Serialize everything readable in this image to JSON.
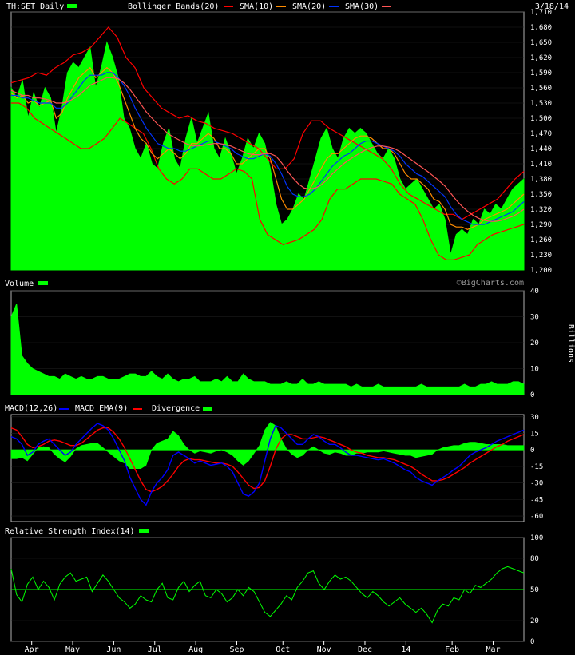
{
  "header": {
    "symbol": "TH:SET Daily",
    "overlays": [
      "Bollinger Bands(20)",
      "SMA(10)",
      "SMA(20)",
      "SMA(30)"
    ],
    "date": "3/18/14",
    "watermark": "©BigCharts.com"
  },
  "colors": {
    "background": "#000000",
    "panel_bg": "#ffffff",
    "grid": "#c8c8c8",
    "price_fill": "#00ff00",
    "bollinger": "#ff0000",
    "sma10": "#ff8c00",
    "sma20": "#0033ff",
    "sma30": "#ff5555",
    "macd": "#0000ff",
    "macd_ema": "#ff0000",
    "rsi": "#00ff00"
  },
  "chart_data": [
    {
      "type": "area",
      "id": "price",
      "ylim": [
        1200,
        1710
      ],
      "yticks": [
        "1,200",
        "1,230",
        "1,260",
        "1,290",
        "1,320",
        "1,350",
        "1,380",
        "1,410",
        "1,440",
        "1,470",
        "1,500",
        "1,530",
        "1,560",
        "1,590",
        "1,620",
        "1,650",
        "1,680",
        "1,710"
      ],
      "ytick_values": [
        1200,
        1230,
        1260,
        1290,
        1320,
        1350,
        1380,
        1410,
        1440,
        1470,
        1500,
        1530,
        1560,
        1590,
        1620,
        1650,
        1680,
        1710
      ],
      "xlim": [
        0,
        240
      ],
      "series": [
        {
          "values": [
            1560,
            1540,
            1575,
            1500,
            1550,
            1520,
            1560,
            1540,
            1470,
            1520,
            1590,
            1610,
            1600,
            1620,
            1640,
            1560,
            1600,
            1650,
            1620,
            1580,
            1500,
            1480,
            1440,
            1420,
            1450,
            1410,
            1400,
            1450,
            1480,
            1420,
            1400,
            1460,
            1500,
            1450,
            1480,
            1510,
            1440,
            1420,
            1460,
            1430,
            1390,
            1420,
            1460,
            1440,
            1470,
            1450,
            1400,
            1330,
            1290,
            1300,
            1320,
            1350,
            1340,
            1380,
            1420,
            1460,
            1480,
            1440,
            1420,
            1460,
            1480,
            1470,
            1480,
            1470,
            1450,
            1430,
            1420,
            1440,
            1420,
            1380,
            1360,
            1370,
            1380,
            1360,
            1340,
            1320,
            1330,
            1300,
            1230,
            1270,
            1280,
            1270,
            1300,
            1290,
            1320,
            1310,
            1330,
            1320,
            1340,
            1360,
            1370,
            1380
          ]
        },
        {
          "values": [
            1570,
            1575,
            1580,
            1590,
            1585,
            1600,
            1610,
            1625,
            1630,
            1640,
            1660,
            1680,
            1660,
            1620,
            1600,
            1560,
            1540,
            1520,
            1510,
            1500,
            1505,
            1495,
            1490,
            1480,
            1475,
            1470,
            1460,
            1450,
            1440,
            1420,
            1400,
            1400,
            1420,
            1470,
            1495,
            1495,
            1480,
            1470,
            1460,
            1450,
            1440,
            1430,
            1420,
            1400,
            1370,
            1350,
            1340,
            1330,
            1320,
            1310,
            1310,
            1300,
            1310,
            1320,
            1330,
            1340,
            1360,
            1380,
            1395
          ]
        },
        {
          "values": [
            1550,
            1540,
            1545,
            1530,
            1535,
            1525,
            1530,
            1535,
            1500,
            1510,
            1540,
            1560,
            1580,
            1590,
            1600,
            1580,
            1590,
            1600,
            1590,
            1570,
            1540,
            1510,
            1480,
            1460,
            1450,
            1430,
            1420,
            1430,
            1440,
            1430,
            1420,
            1430,
            1450,
            1450,
            1460,
            1470,
            1460,
            1440,
            1440,
            1430,
            1410,
            1410,
            1420,
            1430,
            1440,
            1440,
            1420,
            1380,
            1340,
            1320,
            1320,
            1330,
            1340,
            1360,
            1380,
            1400,
            1420,
            1430,
            1430,
            1440,
            1450,
            1460,
            1465,
            1465,
            1460,
            1450,
            1440,
            1440,
            1430,
            1410,
            1390,
            1380,
            1380,
            1370,
            1360,
            1340,
            1335,
            1320,
            1290,
            1285,
            1285,
            1280,
            1285,
            1290,
            1300,
            1305,
            1310,
            1315,
            1320,
            1330,
            1340,
            1350
          ]
        },
        {
          "values": [
            1545,
            1545,
            1540,
            1540,
            1535,
            1530,
            1530,
            1530,
            1520,
            1520,
            1530,
            1545,
            1560,
            1575,
            1585,
            1585,
            1585,
            1590,
            1590,
            1580,
            1565,
            1545,
            1520,
            1500,
            1480,
            1465,
            1450,
            1445,
            1440,
            1440,
            1435,
            1435,
            1440,
            1445,
            1450,
            1455,
            1455,
            1450,
            1445,
            1440,
            1430,
            1425,
            1420,
            1420,
            1425,
            1430,
            1425,
            1410,
            1390,
            1365,
            1350,
            1345,
            1345,
            1350,
            1360,
            1375,
            1390,
            1405,
            1415,
            1425,
            1430,
            1440,
            1450,
            1455,
            1455,
            1450,
            1445,
            1440,
            1435,
            1425,
            1410,
            1400,
            1390,
            1385,
            1375,
            1365,
            1355,
            1345,
            1325,
            1310,
            1300,
            1295,
            1290,
            1290,
            1290,
            1295,
            1300,
            1305,
            1310,
            1315,
            1325,
            1335
          ]
        },
        {
          "values": [
            1555,
            1550,
            1545,
            1545,
            1540,
            1540,
            1538,
            1535,
            1530,
            1530,
            1532,
            1538,
            1545,
            1555,
            1565,
            1570,
            1575,
            1580,
            1580,
            1578,
            1570,
            1558,
            1543,
            1528,
            1512,
            1500,
            1488,
            1478,
            1468,
            1462,
            1456,
            1450,
            1446,
            1445,
            1446,
            1448,
            1450,
            1450,
            1448,
            1445,
            1440,
            1435,
            1430,
            1428,
            1428,
            1430,
            1430,
            1425,
            1412,
            1396,
            1382,
            1370,
            1362,
            1360,
            1362,
            1368,
            1378,
            1390,
            1400,
            1410,
            1418,
            1425,
            1432,
            1438,
            1442,
            1445,
            1445,
            1443,
            1440,
            1434,
            1426,
            1418,
            1410,
            1402,
            1394,
            1385,
            1376,
            1366,
            1352,
            1338,
            1326,
            1316,
            1308,
            1302,
            1298,
            1296,
            1296,
            1298,
            1302,
            1306,
            1312,
            1320
          ]
        },
        {
          "values": [
            1530,
            1530,
            1520,
            1500,
            1490,
            1480,
            1470,
            1460,
            1450,
            1440,
            1440,
            1450,
            1460,
            1480,
            1500,
            1490,
            1480,
            1470,
            1440,
            1400,
            1380,
            1370,
            1380,
            1400,
            1400,
            1390,
            1380,
            1380,
            1390,
            1400,
            1395,
            1380,
            1300,
            1270,
            1260,
            1250,
            1255,
            1260,
            1270,
            1280,
            1300,
            1340,
            1360,
            1360,
            1370,
            1380,
            1380,
            1380,
            1375,
            1370,
            1350,
            1340,
            1330,
            1300,
            1260,
            1230,
            1220,
            1220,
            1225,
            1230,
            1250,
            1260,
            1270,
            1275,
            1280,
            1285,
            1290
          ]
        }
      ]
    },
    {
      "type": "area",
      "id": "volume",
      "title": "Volume",
      "ylabel": "Billions",
      "ylim": [
        0,
        40
      ],
      "yticks": [
        "0",
        "10",
        "20",
        "30",
        "40"
      ],
      "ytick_values": [
        0,
        10,
        20,
        30,
        40
      ],
      "values": [
        30,
        35,
        15,
        12,
        10,
        9,
        8,
        7,
        7,
        6,
        8,
        7,
        6,
        7,
        6,
        6,
        7,
        7,
        6,
        6,
        6,
        7,
        8,
        8,
        7,
        7,
        9,
        7,
        6,
        8,
        6,
        5,
        6,
        6,
        7,
        5,
        5,
        5,
        6,
        5,
        7,
        5,
        5,
        8,
        6,
        5,
        5,
        5,
        4,
        4,
        4,
        5,
        4,
        4,
        6,
        4,
        4,
        5,
        4,
        4,
        4,
        4,
        4,
        3,
        4,
        3,
        3,
        3,
        4,
        3,
        3,
        3,
        3,
        3,
        3,
        3,
        4,
        3,
        3,
        3,
        3,
        3,
        3,
        3,
        4,
        3,
        3,
        4,
        4,
        5,
        4,
        4,
        4,
        5,
        5,
        4
      ]
    },
    {
      "type": "line",
      "id": "macd",
      "title": "MACD(12,26)",
      "series_names": [
        "MACD EMA(9)",
        "Divergence"
      ],
      "ylim": [
        -65,
        32
      ],
      "yticks": [
        "30",
        "15",
        "0",
        "-15",
        "-30",
        "-45",
        "-60"
      ],
      "ytick_values": [
        30,
        15,
        0,
        -15,
        -30,
        -45,
        -60
      ],
      "series": [
        {
          "values": [
            12,
            10,
            5,
            -5,
            -2,
            5,
            8,
            10,
            5,
            0,
            -5,
            -2,
            5,
            10,
            15,
            20,
            24,
            22,
            18,
            10,
            0,
            -10,
            -25,
            -35,
            -45,
            -50,
            -38,
            -30,
            -25,
            -18,
            -5,
            -2,
            -5,
            -8,
            -12,
            -10,
            -12,
            -14,
            -13,
            -12,
            -15,
            -20,
            -30,
            -40,
            -42,
            -38,
            -30,
            -10,
            10,
            22,
            20,
            15,
            10,
            5,
            5,
            10,
            14,
            12,
            8,
            5,
            5,
            2,
            -2,
            -5,
            -5,
            -6,
            -7,
            -8,
            -9,
            -8,
            -10,
            -12,
            -15,
            -18,
            -20,
            -25,
            -28,
            -30,
            -32,
            -28,
            -25,
            -22,
            -18,
            -15,
            -10,
            -5,
            -2,
            0,
            2,
            5,
            8,
            10,
            12,
            14,
            16,
            18
          ]
        },
        {
          "values": [
            20,
            18,
            12,
            5,
            2,
            3,
            5,
            8,
            9,
            8,
            6,
            4,
            4,
            6,
            10,
            14,
            18,
            20,
            20,
            16,
            10,
            2,
            -8,
            -18,
            -28,
            -36,
            -38,
            -36,
            -33,
            -28,
            -22,
            -15,
            -10,
            -8,
            -9,
            -9,
            -10,
            -11,
            -12,
            -12,
            -13,
            -15,
            -20,
            -26,
            -32,
            -35,
            -34,
            -28,
            -15,
            0,
            10,
            14,
            14,
            12,
            10,
            10,
            11,
            12,
            11,
            9,
            7,
            5,
            3,
            0,
            -2,
            -3,
            -5,
            -6,
            -7,
            -7,
            -8,
            -9,
            -11,
            -13,
            -15,
            -18,
            -22,
            -25,
            -28,
            -28,
            -27,
            -25,
            -22,
            -19,
            -16,
            -12,
            -9,
            -6,
            -3,
            0,
            3,
            5,
            8,
            10,
            12,
            14
          ]
        }
      ],
      "histogram": [
        -8,
        -8,
        -7,
        -10,
        -4,
        2,
        3,
        2,
        -4,
        -8,
        -11,
        -6,
        1,
        4,
        5,
        6,
        6,
        2,
        -2,
        -6,
        -10,
        -12,
        -17,
        -17,
        -17,
        -14,
        0,
        6,
        8,
        10,
        17,
        13,
        5,
        0,
        -3,
        -1,
        -2,
        -3,
        -1,
        0,
        -2,
        -5,
        -10,
        -14,
        -10,
        -3,
        4,
        18,
        25,
        22,
        10,
        1,
        -4,
        -7,
        -5,
        0,
        3,
        0,
        -3,
        -4,
        -2,
        -3,
        -5,
        -5,
        -3,
        -3,
        -2,
        -2,
        -2,
        -1,
        -2,
        -3,
        -4,
        -5,
        -5,
        -7,
        -6,
        -5,
        -4,
        0,
        2,
        3,
        4,
        4,
        6,
        7,
        7,
        6,
        5,
        5,
        5,
        5,
        4,
        4,
        4,
        4
      ]
    },
    {
      "type": "line",
      "id": "rsi",
      "title": "Relative Strength Index(14)",
      "ylim": [
        0,
        100
      ],
      "yticks": [
        "0",
        "20",
        "50",
        "80",
        "100"
      ],
      "ytick_values": [
        0,
        20,
        50,
        80,
        100
      ],
      "reference_line": 50,
      "values": [
        70,
        45,
        38,
        55,
        62,
        50,
        58,
        52,
        40,
        55,
        62,
        66,
        58,
        60,
        62,
        48,
        56,
        64,
        58,
        50,
        42,
        38,
        32,
        36,
        44,
        40,
        38,
        50,
        56,
        42,
        40,
        52,
        58,
        48,
        54,
        58,
        44,
        42,
        50,
        46,
        38,
        42,
        50,
        44,
        52,
        48,
        38,
        28,
        24,
        30,
        36,
        44,
        40,
        52,
        58,
        66,
        68,
        56,
        50,
        58,
        64,
        60,
        62,
        58,
        52,
        46,
        42,
        48,
        44,
        38,
        34,
        38,
        42,
        36,
        32,
        28,
        32,
        26,
        18,
        30,
        36,
        34,
        42,
        40,
        50,
        46,
        54,
        52,
        56,
        60,
        66,
        70,
        72,
        70,
        68,
        66
      ]
    }
  ],
  "x_axis": {
    "labels": [
      "Apr",
      "May",
      "Jun",
      "Jul",
      "Aug",
      "Sep",
      "Oct",
      "Nov",
      "Dec",
      "14",
      "Feb",
      "Mar"
    ],
    "positions": [
      0.04,
      0.12,
      0.2,
      0.28,
      0.36,
      0.44,
      0.53,
      0.61,
      0.69,
      0.77,
      0.86,
      0.94
    ]
  }
}
